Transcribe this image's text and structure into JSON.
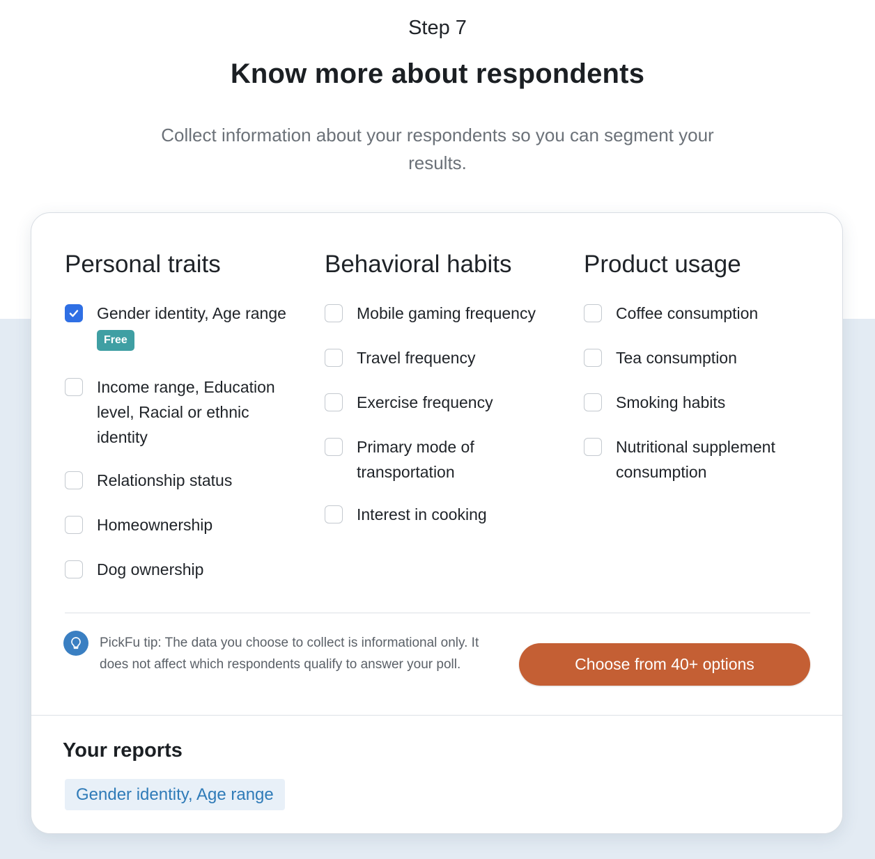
{
  "header": {
    "step": "Step 7",
    "title": "Know more about respondents",
    "subtitle": "Collect information about your respondents so you can segment your results."
  },
  "columns": [
    {
      "title": "Personal traits",
      "options": [
        {
          "label": "Gender identity, Age range",
          "checked": true,
          "badge": "Free"
        },
        {
          "label": "Income range, Education level, Racial or ethnic identity",
          "checked": false
        },
        {
          "label": "Relationship status",
          "checked": false
        },
        {
          "label": "Homeownership",
          "checked": false
        },
        {
          "label": "Dog ownership",
          "checked": false
        }
      ]
    },
    {
      "title": "Behavioral habits",
      "options": [
        {
          "label": "Mobile gaming frequency",
          "checked": false
        },
        {
          "label": "Travel frequency",
          "checked": false
        },
        {
          "label": "Exercise frequency",
          "checked": false
        },
        {
          "label": "Primary mode of transportation",
          "checked": false
        },
        {
          "label": "Interest in cooking",
          "checked": false
        }
      ]
    },
    {
      "title": "Product usage",
      "options": [
        {
          "label": "Coffee consumption",
          "checked": false
        },
        {
          "label": "Tea consumption",
          "checked": false
        },
        {
          "label": "Smoking habits",
          "checked": false
        },
        {
          "label": "Nutritional supplement consumption",
          "checked": false
        }
      ]
    }
  ],
  "tip": {
    "icon": "lightbulb-icon",
    "text": "PickFu tip: The data you choose to collect is informational only. It does not affect which respondents qualify to answer your poll."
  },
  "cta": {
    "label": "Choose from 40+ options"
  },
  "reports": {
    "title": "Your reports",
    "items": [
      "Gender identity, Age range"
    ]
  },
  "colors": {
    "accent_checkbox": "#2f6fe4",
    "cta": "#c45f34",
    "badge": "#3f9fa3",
    "chip_bg": "#e8f0f8",
    "chip_text": "#2f7bb8"
  }
}
